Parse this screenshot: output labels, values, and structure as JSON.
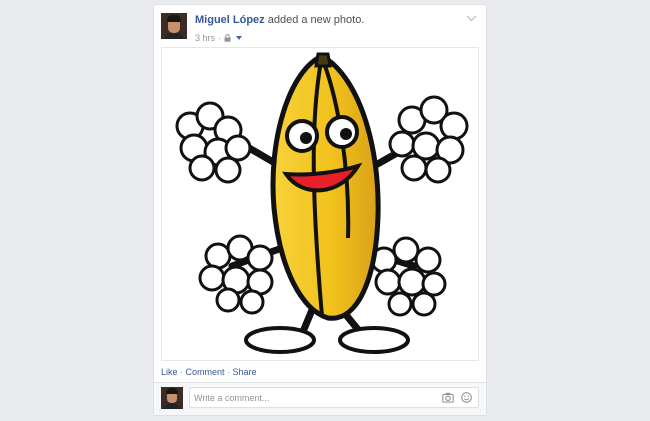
{
  "post": {
    "author": "Miguel López",
    "action": " added a new photo.",
    "time": "3 hrs",
    "dot": "·"
  },
  "actions": {
    "like": "Like",
    "comment": "Comment",
    "share": "Share",
    "separator": " · "
  },
  "comment_box": {
    "placeholder": "Write a comment..."
  },
  "colors": {
    "link": "#365899",
    "background": "#e9ebee",
    "banana": "#f2c21c"
  }
}
